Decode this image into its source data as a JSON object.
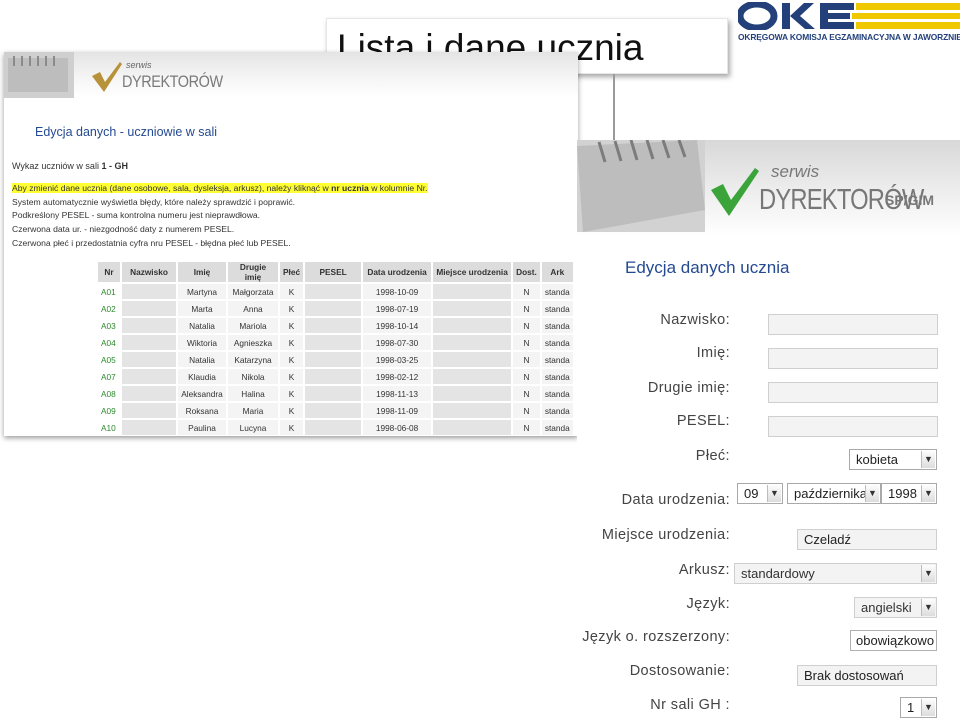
{
  "slide": {
    "title": "Lista i dane ucznia"
  },
  "logo": {
    "caption": "OKRĘGOWA KOMISJA EGZAMINACYJNA W JAWORZNIE",
    "colors": {
      "blue": "#23407a",
      "yellow": "#f0c800"
    }
  },
  "left_panel": {
    "brand_top": "serwis",
    "brand_name": "DYREKTORÓW",
    "heading": "Edycja danych - uczniowie w sali",
    "room_prefix": "Wykaz uczniów w sali",
    "room_id": "1 - GH",
    "notes": {
      "line1_a": "Aby zmienić dane ucznia (dane osobowe, sala, dysleksja, arkusz), należy kliknąć w ",
      "line1_b": "nr ucznia",
      "line1_c": " w kolumnie Nr.",
      "line2": "System automatycznie wyświetla błędy, które należy sprawdzić i poprawić.",
      "line3": "Podkreślony PESEL - suma kontrolna numeru jest nieprawdłowa.",
      "line4": "Czerwona data ur. - niezgodność daty z numerem PESEL.",
      "line5": "Czerwona płeć i przedostatnia cyfra nru PESEL - błędna płeć lub PESEL."
    },
    "columns": [
      "Nr",
      "Nazwisko",
      "Imię",
      "Drugie imię",
      "Płeć",
      "PESEL",
      "Data urodzenia",
      "Miejsce urodzenia",
      "Dost.",
      "Ark"
    ],
    "rows": [
      {
        "nr": "A01",
        "imie": "Martyna",
        "drugie": "Małgorzata",
        "plec": "K",
        "data": "1998-10-09",
        "dost": "N",
        "ark": "standa"
      },
      {
        "nr": "A02",
        "imie": "Marta",
        "drugie": "Anna",
        "plec": "K",
        "data": "1998-07-19",
        "dost": "N",
        "ark": "standa"
      },
      {
        "nr": "A03",
        "imie": "Natalia",
        "drugie": "Mariola",
        "plec": "K",
        "data": "1998-10-14",
        "dost": "N",
        "ark": "standa"
      },
      {
        "nr": "A04",
        "imie": "Wiktoria",
        "drugie": "Agnieszka",
        "plec": "K",
        "data": "1998-07-30",
        "dost": "N",
        "ark": "standa"
      },
      {
        "nr": "A05",
        "imie": "Natalia",
        "drugie": "Katarzyna",
        "plec": "K",
        "data": "1998-03-25",
        "dost": "N",
        "ark": "standa"
      },
      {
        "nr": "A07",
        "imie": "Klaudia",
        "drugie": "Nikola",
        "plec": "K",
        "data": "1998-02-12",
        "dost": "N",
        "ark": "standa"
      },
      {
        "nr": "A08",
        "imie": "Aleksandra",
        "drugie": "Halina",
        "plec": "K",
        "data": "1998-11-13",
        "dost": "N",
        "ark": "standa"
      },
      {
        "nr": "A09",
        "imie": "Roksana",
        "drugie": "Maria",
        "plec": "K",
        "data": "1998-11-09",
        "dost": "N",
        "ark": "standa"
      },
      {
        "nr": "A10",
        "imie": "Paulina",
        "drugie": "Lucyna",
        "plec": "K",
        "data": "1998-06-08",
        "dost": "N",
        "ark": "standa"
      }
    ]
  },
  "right_panel": {
    "brand_top": "serwis",
    "brand_name": "DYREKTORÓW",
    "brand_suffix": "SP/GIM",
    "heading": "Edycja danych ucznia",
    "labels": {
      "nazwisko": "Nazwisko:",
      "imie": "Imię:",
      "drugie_imie": "Drugie imię:",
      "pesel": "PESEL:",
      "plec": "Płeć:",
      "data_urodzenia": "Data urodzenia:",
      "miejsce_urodzenia": "Miejsce urodzenia:",
      "arkusz": "Arkusz:",
      "jezyk": "Język:",
      "jezyk_rozszerzony": "Język o. rozszerzony:",
      "dostosowanie": "Dostosowanie:",
      "nr_sali": "Nr sali GH :"
    },
    "values": {
      "nazwisko": "",
      "imie": "",
      "drugie_imie": "",
      "pesel": "",
      "plec": "kobieta",
      "dzien": "09",
      "miesiac": "października",
      "rok": "1998",
      "miejsce_urodzenia": "Czeladź",
      "arkusz": "standardowy",
      "jezyk": "angielski",
      "jezyk_rozszerzony": "obowiązkowo",
      "dostosowanie": "Brak dostosowań",
      "nr_sali": "1"
    },
    "colors": {
      "heading": "#244a92",
      "brand_green": "#3aa33a"
    }
  }
}
